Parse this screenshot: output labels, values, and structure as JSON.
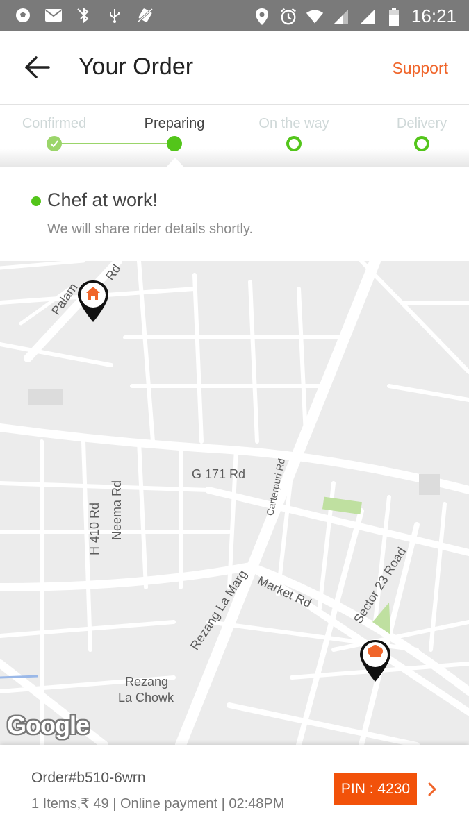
{
  "status_bar": {
    "time": "16:21",
    "left_icons": [
      "soccer-ball-icon",
      "mail-icon",
      "bluetooth-off-icon",
      "usb-icon",
      "no-vibrate-icon"
    ],
    "right_icons": [
      "location-icon",
      "alarm-icon",
      "wifi-icon",
      "signal-icon",
      "signal-icon",
      "battery-icon"
    ]
  },
  "header": {
    "title": "Your Order",
    "support_label": "Support"
  },
  "progress": {
    "steps": [
      {
        "label": "Confirmed",
        "state": "done"
      },
      {
        "label": "Preparing",
        "state": "active"
      },
      {
        "label": "On the way",
        "state": "pending"
      },
      {
        "label": "Delivery",
        "state": "pending"
      }
    ]
  },
  "status": {
    "title": "Chef at work!",
    "subtitle": "We will share rider details shortly."
  },
  "map": {
    "labels": [
      "Palam",
      "Rd",
      "G 171 Rd",
      "Carterpuri Rd",
      "H 410 Rd",
      "Neema Rd",
      "Market Rd",
      "Sector 23 Road",
      "Rezang La Marg",
      "Rezang",
      "La Chowk"
    ],
    "watermark": "Google",
    "markers": [
      "home-pin-icon",
      "chef-pin-icon"
    ]
  },
  "order": {
    "id": "Order#b510-6wrn",
    "meta": "1 Items,₹ 49 | Online payment | 02:48PM",
    "pin": "PIN : 4230"
  },
  "colors": {
    "accent": "#f0652a",
    "pin_badge": "#f2520a",
    "progress_green": "#53c51a",
    "status_bar": "#7a7a7a",
    "map_bg": "#ececec",
    "road": "#ffffff",
    "park": "#bfe0a0"
  }
}
